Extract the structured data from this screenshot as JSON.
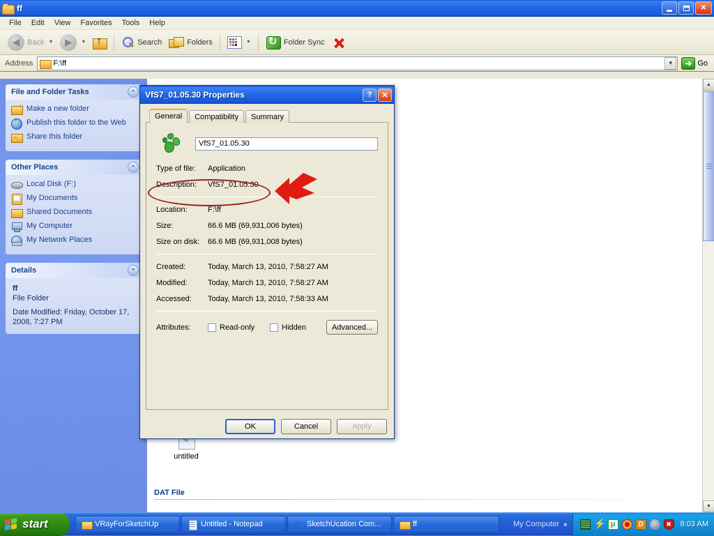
{
  "window": {
    "title": "ff",
    "icon": "folder-icon",
    "controls": {
      "minimize": "minimize-icon",
      "restore": "restore-icon",
      "close": "close-icon"
    }
  },
  "menu": {
    "items": [
      "File",
      "Edit",
      "View",
      "Favorites",
      "Tools",
      "Help"
    ]
  },
  "toolbar": {
    "back_label": "Back",
    "forward_label": "",
    "up_label": "",
    "search_label": "Search",
    "folders_label": "Folders",
    "views_label": "",
    "foldersync_label": "Folder Sync",
    "close_label": ""
  },
  "address": {
    "label": "Address",
    "value": "F:\\ff",
    "go_label": "Go"
  },
  "sidebar": {
    "panels": [
      {
        "title": "File and Folder Tasks",
        "items": [
          {
            "label": "Make a new folder",
            "icon": "new-folder-icon"
          },
          {
            "label": "Publish this folder to the Web",
            "icon": "publish-web-icon"
          },
          {
            "label": "Share this folder",
            "icon": "share-folder-icon"
          }
        ]
      },
      {
        "title": "Other Places",
        "items": [
          {
            "label": "Local Disk (F:)",
            "icon": "disk-icon"
          },
          {
            "label": "My Documents",
            "icon": "my-documents-icon"
          },
          {
            "label": "Shared Documents",
            "icon": "shared-documents-icon"
          },
          {
            "label": "My Computer",
            "icon": "my-computer-icon"
          },
          {
            "label": "My Network Places",
            "icon": "network-places-icon"
          }
        ]
      }
    ],
    "details": {
      "title": "Details",
      "name": "ff",
      "type": "File Folder",
      "date_modified": "Date Modified: Friday, October 17, 2008, 7:27 PM"
    }
  },
  "filelist": {
    "group_header": "DAT File",
    "items": [
      {
        "label": "untitled",
        "icon": "dat-file-icon"
      }
    ]
  },
  "dialog": {
    "title": "VfS7_01.05.30 Properties",
    "help_label": "?",
    "close_label": "✕",
    "tabs": [
      {
        "label": "General",
        "active": true
      },
      {
        "label": "Compatibility",
        "active": false
      },
      {
        "label": "Summary",
        "active": false
      }
    ],
    "filename": "VfS7_01.05.30",
    "file_icon": "application-icon",
    "rows": [
      {
        "key": "Type of file:",
        "value": "Application"
      },
      {
        "key": "Description:",
        "value": "VfS7_01.05.30"
      },
      {
        "key": "Location:",
        "value": "F:\\ff"
      },
      {
        "key": "Size:",
        "value": "66.6 MB (69,931,006 bytes)"
      },
      {
        "key": "Size on disk:",
        "value": "66.6 MB (69,931,008 bytes)"
      },
      {
        "key": "Created:",
        "value": "Today, March 13, 2010, 7:58:27 AM"
      },
      {
        "key": "Modified:",
        "value": "Today, March 13, 2010, 7:58:27 AM"
      },
      {
        "key": "Accessed:",
        "value": "Today, March 13, 2010, 7:58:33 AM"
      }
    ],
    "attributes": {
      "label": "Attributes:",
      "readonly_label": "Read-only",
      "readonly_checked": false,
      "hidden_label": "Hidden",
      "hidden_checked": false,
      "advanced_label": "Advanced..."
    },
    "buttons": {
      "ok": "OK",
      "cancel": "Cancel",
      "apply": "Apply",
      "apply_disabled": true
    }
  },
  "annotations": {
    "ellipse_color": "#9e1f1f",
    "arrow_color": "#e01b10",
    "target": "Description: VfS7_01.05.30"
  },
  "taskbar": {
    "start_label": "start",
    "tasks": [
      {
        "label": "VRayForSketchUp",
        "icon": "folder-icon"
      },
      {
        "label": "Untitled - Notepad",
        "icon": "notepad-icon"
      },
      {
        "label": "SketchUcation Com...",
        "icon": "internet-explorer-icon"
      },
      {
        "label": "ff",
        "icon": "folder-icon"
      }
    ],
    "group_label": "My Computer",
    "group_chevron": "»",
    "clock": "8:03 AM",
    "tray_icons": [
      {
        "name": "network-icon",
        "color": "#2f6b2f"
      },
      {
        "name": "power-bolt-icon",
        "color": "#f2c21a"
      },
      {
        "name": "utorrent-icon",
        "color": "#2fa02f"
      },
      {
        "name": "media-icon",
        "color": "#e8741a"
      },
      {
        "name": "daemon-tools-icon",
        "color": "#e08a1a"
      },
      {
        "name": "volume-icon",
        "color": "#7e8ea6"
      },
      {
        "name": "security-shield-icon",
        "color": "#c41b1b"
      }
    ]
  }
}
